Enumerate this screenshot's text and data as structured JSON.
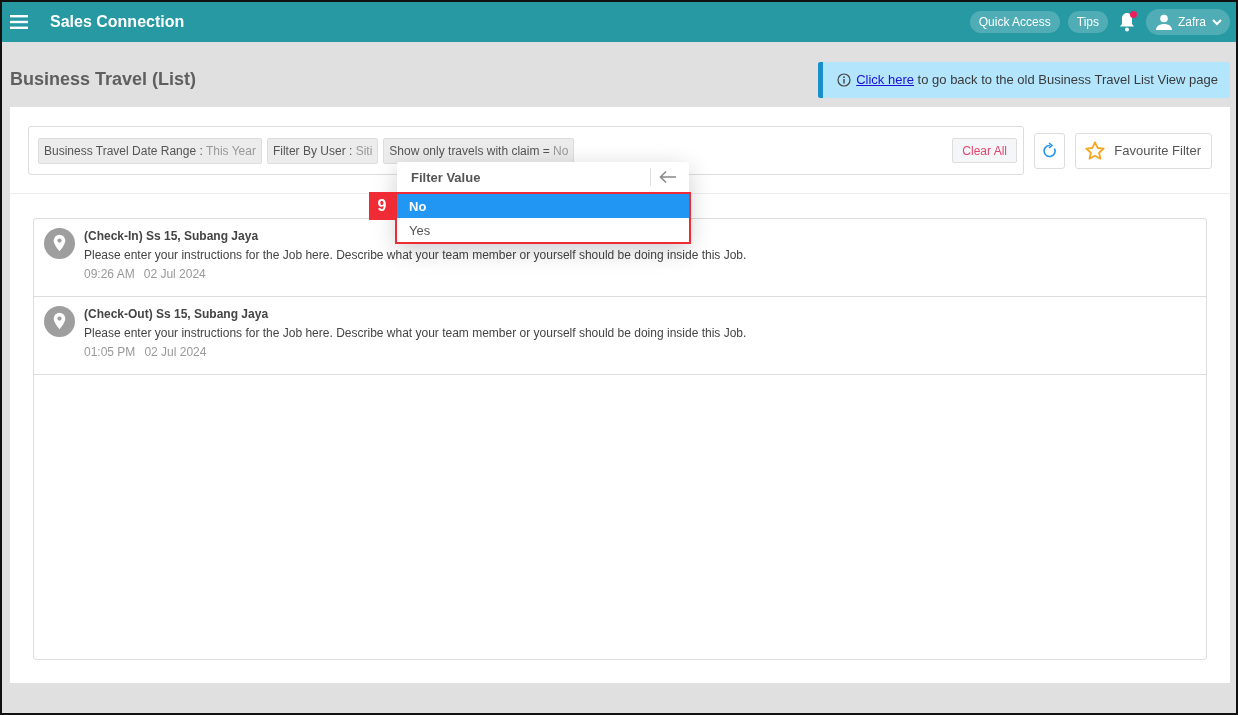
{
  "header": {
    "app_title": "Sales Connection",
    "quick_access": "Quick Access",
    "tips": "Tips",
    "notification_unread": true,
    "user": "Zafra"
  },
  "page": {
    "title": "Business Travel (List)"
  },
  "banner": {
    "link": "Click here",
    "text": " to go back to the old Business Travel List View page"
  },
  "filters": [
    {
      "label": "Business Travel Date Range",
      "sep": ":",
      "value": "This Year"
    },
    {
      "label": "Filter By User",
      "sep": ":",
      "value": "Siti"
    },
    {
      "label": "Show only travels with claim",
      "sep": "=",
      "value": "No"
    }
  ],
  "clear_all": "Clear All",
  "favourite_filter": "Favourite Filter",
  "dropdown": {
    "title": "Filter Value",
    "step_badge": "9",
    "options": [
      {
        "label": "No",
        "selected": true
      },
      {
        "label": "Yes",
        "selected": false
      }
    ]
  },
  "entries": [
    {
      "title": "(Check-In) Ss 15, Subang Jaya",
      "description": "Please enter your instructions for the Job here. Describe what your team member or yourself should be doing inside this Job.",
      "time": "09:26 AM",
      "date": "02 Jul 2024"
    },
    {
      "title": "(Check-Out) Ss 15, Subang Jaya",
      "description": "Please enter your instructions for the Job here. Describe what your team member or yourself should be doing inside this Job.",
      "time": "01:05 PM",
      "date": "02 Jul 2024"
    }
  ]
}
